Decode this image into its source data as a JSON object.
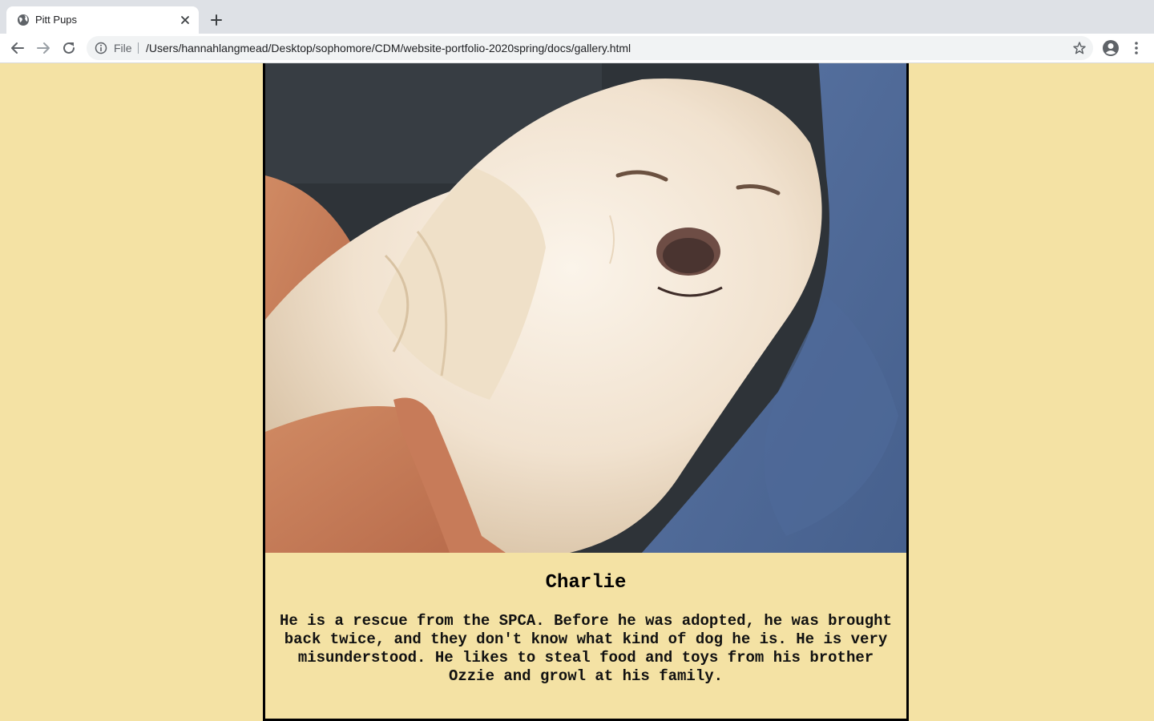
{
  "browser": {
    "tab_title": "Pitt Pups",
    "scheme_label": "File",
    "url": "/Users/hannahlangmead/Desktop/sophomore/CDM/website-portfolio-2020spring/docs/gallery.html",
    "icons": [
      "globe-icon",
      "close-icon",
      "plus-icon",
      "back-arrow-icon",
      "forward-arrow-icon",
      "reload-icon",
      "info-icon",
      "star-icon",
      "profile-icon",
      "kebab-menu-icon"
    ]
  },
  "gallery": {
    "dog": {
      "name": "Charlie",
      "description": "He is a rescue from the SPCA. Before he was adopted, he was brought back twice, and they don't know what kind of dog he is. He is very misunderstood. He likes to steal food and toys from his brother Ozzie and growl at his family."
    }
  },
  "colors": {
    "page_background": "#f4e2a4",
    "card_border": "#000000"
  }
}
